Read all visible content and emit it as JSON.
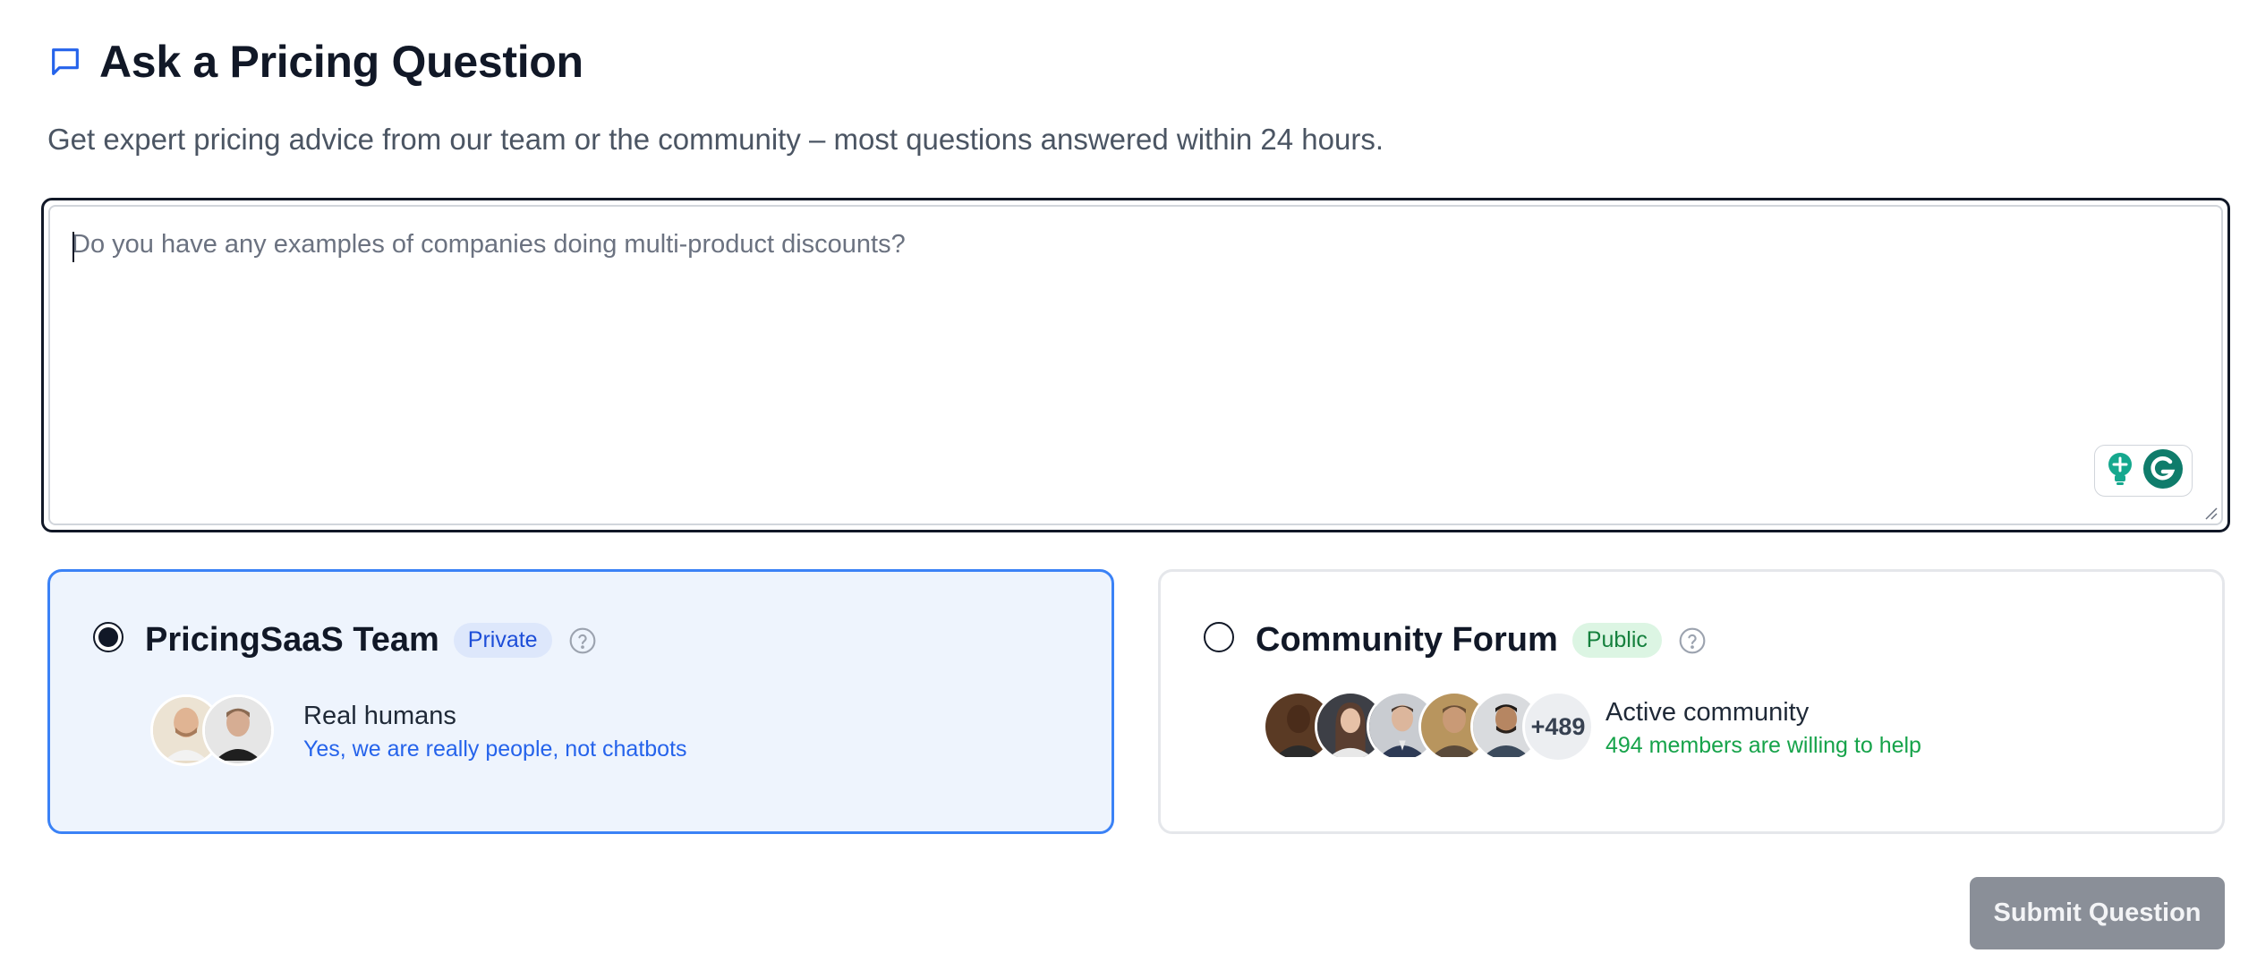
{
  "header": {
    "title": "Ask a Pricing Question",
    "icon": "chat-bubble-icon",
    "accent": "#2563eb"
  },
  "subtitle": "Get expert pricing advice from our team or the community – most questions answered within 24 hours.",
  "question": {
    "value": "",
    "placeholder": "Do you have any examples of companies doing multi-product discounts?"
  },
  "options": [
    {
      "name": "PricingSaaS Team",
      "badge": "Private",
      "selected": true,
      "line1": "Real humans",
      "line2": "Yes, we are really people, not chatbots"
    },
    {
      "name": "Community Forum",
      "badge": "Public",
      "selected": false,
      "avatar_count": "+489",
      "line1": "Active community",
      "line2": "494 members are willing to help"
    }
  ],
  "submit_label": "Submit Question",
  "colors": {
    "selected_border": "#3b82f6",
    "selected_bg": "#eef4fd",
    "private_badge": "#1d4ed8",
    "public_badge": "#15803d",
    "submit_disabled": "#8a8f98"
  }
}
